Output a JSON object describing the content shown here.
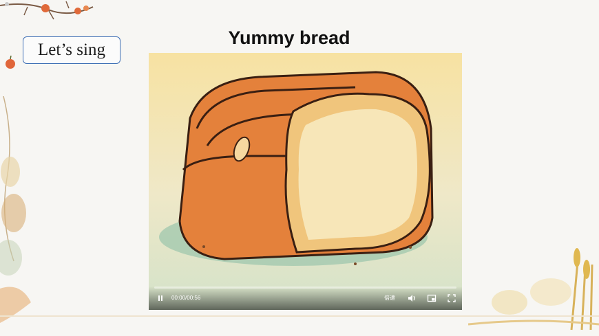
{
  "slide": {
    "badge_label": "Let’s sing",
    "title": "Yummy bread"
  },
  "video": {
    "current_time": "00:00",
    "duration": "00:56",
    "time_label": "00:00/00:56",
    "speed_label": "倍速",
    "progress_fraction": 0,
    "icons": [
      "pause-icon",
      "volume-icon",
      "picture-in-picture-icon",
      "fullscreen-icon"
    ]
  },
  "colors": {
    "badge_border": "#3f6fb5",
    "background": "#f7f6f3",
    "bread_crust": "#e07a32",
    "bread_inside": "#f6e3b0"
  }
}
